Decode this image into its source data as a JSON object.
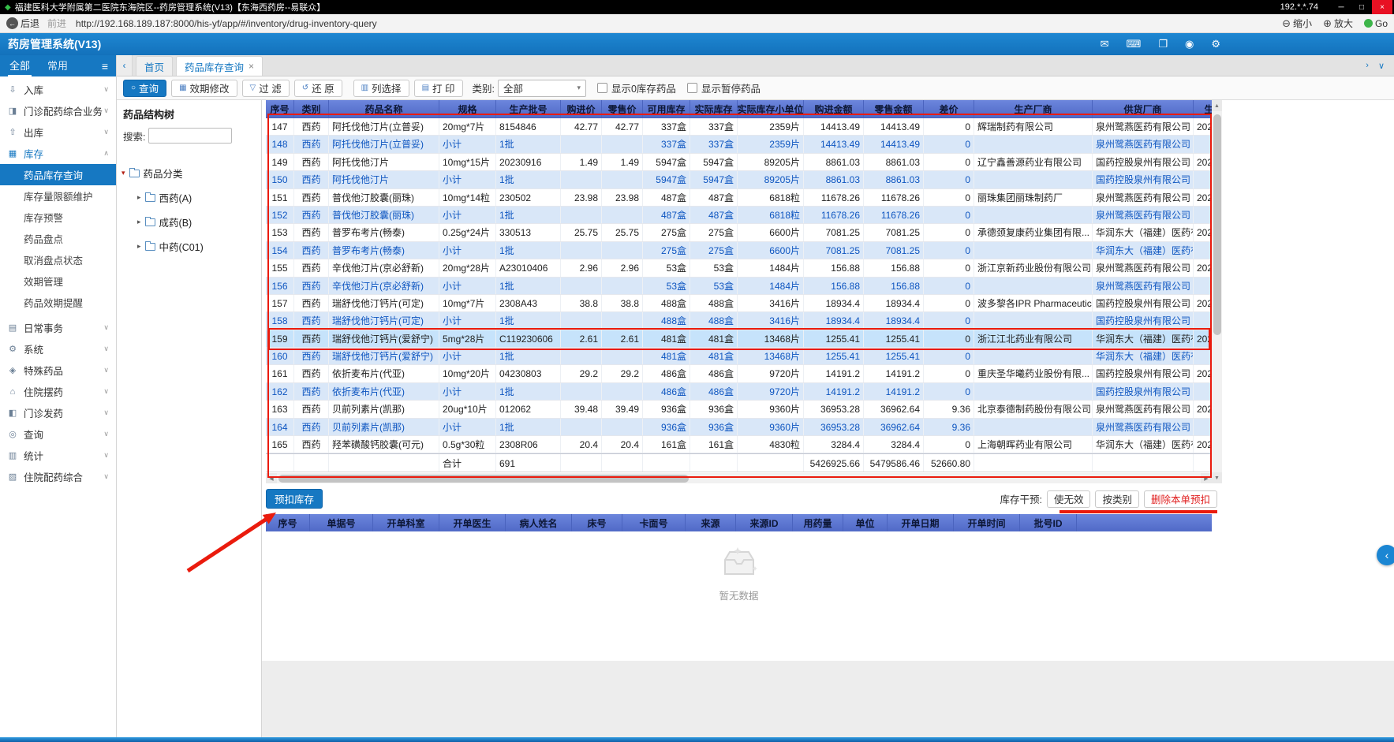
{
  "titlebar": {
    "title": "福建医科大学附属第二医院东海院区--药房管理系统(V13)【东海西药房--易联众】",
    "ip": "192.*.*.74",
    "minimize": "─",
    "maximize": "□",
    "close": "×"
  },
  "addressbar": {
    "back": "后退",
    "forward": "前进",
    "url": "http://192.168.189.187:8000/his-yf/app/#/inventory/drug-inventory-query",
    "zoom_out": "缩小",
    "zoom_in": "放大",
    "go": "Go"
  },
  "appbar": {
    "title": "药房管理系统(V13)",
    "icons": [
      "message-icon",
      "card-icon",
      "layout-icon",
      "monitor-icon",
      "gear-icon"
    ]
  },
  "sidebar": {
    "tabs": [
      {
        "label": "全部",
        "active": true
      },
      {
        "label": "常用",
        "active": false
      }
    ],
    "menu": [
      {
        "label": "入库",
        "icon": "inbound-icon",
        "kind": "item"
      },
      {
        "label": "门诊配药综合业务",
        "icon": "outpatient-icon",
        "kind": "item"
      },
      {
        "label": "出库",
        "icon": "outbound-icon",
        "kind": "item"
      },
      {
        "label": "库存",
        "icon": "stock-icon",
        "kind": "item",
        "active": true,
        "expanded": true
      },
      {
        "label": "药品库存查询",
        "kind": "sub",
        "selected": true
      },
      {
        "label": "库存量限额维护",
        "kind": "sub"
      },
      {
        "label": "库存预警",
        "kind": "sub"
      },
      {
        "label": "药品盘点",
        "kind": "sub"
      },
      {
        "label": "取消盘点状态",
        "kind": "sub"
      },
      {
        "label": "效期管理",
        "kind": "sub"
      },
      {
        "label": "药品效期提醒",
        "kind": "sub"
      },
      {
        "label": "日常事务",
        "icon": "daily-icon",
        "kind": "item",
        "gap": true
      },
      {
        "label": "系统",
        "icon": "system-icon",
        "kind": "item"
      },
      {
        "label": "特殊药品",
        "icon": "special-drug-icon",
        "kind": "item"
      },
      {
        "label": "住院摆药",
        "icon": "inpatient-dispense-icon",
        "kind": "item"
      },
      {
        "label": "门诊发药",
        "icon": "outpatient-dispense-icon",
        "kind": "item"
      },
      {
        "label": "查询",
        "icon": "query-icon",
        "kind": "item"
      },
      {
        "label": "统计",
        "icon": "stats-icon",
        "kind": "item"
      },
      {
        "label": "住院配药综合",
        "icon": "inpatient-combined-icon",
        "kind": "item"
      }
    ]
  },
  "tabbar": {
    "tabs": [
      {
        "label": "首页",
        "active": false,
        "closable": false
      },
      {
        "label": "药品库存查询",
        "active": true,
        "closable": true
      }
    ]
  },
  "toolbar": {
    "buttons": [
      {
        "label": "查询",
        "icon": "search-icon",
        "primary": true,
        "name": "query-button"
      },
      {
        "label": "效期修改",
        "icon": "calendar-icon",
        "name": "expiry-edit-button"
      },
      {
        "label": "过 滤",
        "icon": "filter-icon",
        "name": "filter-button"
      },
      {
        "label": "还 原",
        "icon": "restore-icon",
        "name": "restore-button"
      },
      {
        "label": "列选择",
        "icon": "columns-icon",
        "name": "column-select-button",
        "gap": true
      },
      {
        "label": "打 印",
        "icon": "print-icon",
        "name": "print-button"
      }
    ],
    "category_label": "类别:",
    "category_value": "全部",
    "checkboxes": [
      {
        "label": "显示0库存药品",
        "checked": false,
        "name": "show-zero-stock-checkbox"
      },
      {
        "label": "显示暂停药品",
        "checked": false,
        "name": "show-paused-drug-checkbox"
      }
    ]
  },
  "tree": {
    "title": "药品结构树",
    "search_label": "搜索:",
    "root": "药品分类",
    "nodes": [
      "西药(A)",
      "成药(B)",
      "中药(C01)"
    ]
  },
  "inventory_table": {
    "columns": [
      "序号",
      "类别",
      "药品名称",
      "规格",
      "生产批号",
      "购进价",
      "零售价",
      "可用库存",
      "实际库存",
      "实际库存小单位",
      "购进金额",
      "零售金额",
      "差价",
      "生产厂商",
      "供货厂商",
      "生"
    ],
    "rows": [
      {
        "type": "normal",
        "c": [
          "147",
          "西药",
          "阿托伐他汀片(立普妥)",
          "20mg*7片",
          "8154846",
          "42.77",
          "42.77",
          "337盒",
          "337盒",
          "2359片",
          "14413.49",
          "14413.49",
          "0",
          "辉瑞制药有限公司",
          "泉州鹭燕医药有限公司",
          "202"
        ]
      },
      {
        "type": "subtotal",
        "c": [
          "148",
          "西药",
          "阿托伐他汀片(立普妥)",
          "小计",
          "1批",
          "",
          "",
          "337盒",
          "337盒",
          "2359片",
          "14413.49",
          "14413.49",
          "0",
          "",
          "泉州鹭燕医药有限公司",
          ""
        ]
      },
      {
        "type": "normal",
        "c": [
          "149",
          "西药",
          "阿托伐他汀片",
          "10mg*15片",
          "20230916",
          "1.49",
          "1.49",
          "5947盒",
          "5947盒",
          "89205片",
          "8861.03",
          "8861.03",
          "0",
          "辽宁鑫善源药业有限公司",
          "国药控股泉州有限公司",
          "202"
        ]
      },
      {
        "type": "subtotal",
        "c": [
          "150",
          "西药",
          "阿托伐他汀片",
          "小计",
          "1批",
          "",
          "",
          "5947盒",
          "5947盒",
          "89205片",
          "8861.03",
          "8861.03",
          "0",
          "",
          "国药控股泉州有限公司",
          ""
        ]
      },
      {
        "type": "normal",
        "c": [
          "151",
          "西药",
          "普伐他汀胶囊(丽珠)",
          "10mg*14粒",
          "230502",
          "23.98",
          "23.98",
          "487盒",
          "487盒",
          "6818粒",
          "11678.26",
          "11678.26",
          "0",
          "丽珠集团丽珠制药厂",
          "泉州鹭燕医药有限公司",
          "202"
        ]
      },
      {
        "type": "subtotal",
        "c": [
          "152",
          "西药",
          "普伐他汀胶囊(丽珠)",
          "小计",
          "1批",
          "",
          "",
          "487盒",
          "487盒",
          "6818粒",
          "11678.26",
          "11678.26",
          "0",
          "",
          "泉州鹭燕医药有限公司",
          ""
        ]
      },
      {
        "type": "normal",
        "c": [
          "153",
          "西药",
          "普罗布考片(畅泰)",
          "0.25g*24片",
          "330513",
          "25.75",
          "25.75",
          "275盒",
          "275盒",
          "6600片",
          "7081.25",
          "7081.25",
          "0",
          "承德颈复康药业集团有限...",
          "华润东大（福建）医药有...",
          "202"
        ]
      },
      {
        "type": "subtotal",
        "c": [
          "154",
          "西药",
          "普罗布考片(畅泰)",
          "小计",
          "1批",
          "",
          "",
          "275盒",
          "275盒",
          "6600片",
          "7081.25",
          "7081.25",
          "0",
          "",
          "华润东大（福建）医药有...",
          ""
        ]
      },
      {
        "type": "normal",
        "c": [
          "155",
          "西药",
          "辛伐他汀片(京必舒新)",
          "20mg*28片",
          "A23010406",
          "2.96",
          "2.96",
          "53盒",
          "53盒",
          "1484片",
          "156.88",
          "156.88",
          "0",
          "浙江京新药业股份有限公司",
          "泉州鹭燕医药有限公司",
          "202"
        ]
      },
      {
        "type": "subtotal",
        "c": [
          "156",
          "西药",
          "辛伐他汀片(京必舒新)",
          "小计",
          "1批",
          "",
          "",
          "53盒",
          "53盒",
          "1484片",
          "156.88",
          "156.88",
          "0",
          "",
          "泉州鹭燕医药有限公司",
          ""
        ]
      },
      {
        "type": "normal",
        "c": [
          "157",
          "西药",
          "瑞舒伐他汀钙片(可定)",
          "10mg*7片",
          "2308A43",
          "38.8",
          "38.8",
          "488盒",
          "488盒",
          "3416片",
          "18934.4",
          "18934.4",
          "0",
          "波多黎各IPR Pharmaceutica...",
          "国药控股泉州有限公司",
          "202"
        ]
      },
      {
        "type": "subtotal",
        "c": [
          "158",
          "西药",
          "瑞舒伐他汀钙片(可定)",
          "小计",
          "1批",
          "",
          "",
          "488盒",
          "488盒",
          "3416片",
          "18934.4",
          "18934.4",
          "0",
          "",
          "国药控股泉州有限公司",
          ""
        ]
      },
      {
        "type": "selected",
        "c": [
          "159",
          "西药",
          "瑞舒伐他汀钙片(爱舒宁)",
          "5mg*28片",
          "C119230606",
          "2.61",
          "2.61",
          "481盒",
          "481盒",
          "13468片",
          "1255.41",
          "1255.41",
          "0",
          "浙江江北药业有限公司",
          "华润东大（福建）医药有...",
          "202"
        ]
      },
      {
        "type": "subtotal",
        "c": [
          "160",
          "西药",
          "瑞舒伐他汀钙片(爱舒宁)",
          "小计",
          "1批",
          "",
          "",
          "481盒",
          "481盒",
          "13468片",
          "1255.41",
          "1255.41",
          "0",
          "",
          "华润东大（福建）医药有...",
          ""
        ]
      },
      {
        "type": "normal",
        "c": [
          "161",
          "西药",
          "依折麦布片(代亚)",
          "10mg*20片",
          "04230803",
          "29.2",
          "29.2",
          "486盒",
          "486盒",
          "9720片",
          "14191.2",
          "14191.2",
          "0",
          "重庆圣华曦药业股份有限...",
          "国药控股泉州有限公司",
          "202"
        ]
      },
      {
        "type": "subtotal",
        "c": [
          "162",
          "西药",
          "依折麦布片(代亚)",
          "小计",
          "1批",
          "",
          "",
          "486盒",
          "486盒",
          "9720片",
          "14191.2",
          "14191.2",
          "0",
          "",
          "国药控股泉州有限公司",
          ""
        ]
      },
      {
        "type": "normal",
        "c": [
          "163",
          "西药",
          "贝前列素片(凯那)",
          "20ug*10片",
          "012062",
          "39.48",
          "39.49",
          "936盒",
          "936盒",
          "9360片",
          "36953.28",
          "36962.64",
          "9.36",
          "北京泰德制药股份有限公司",
          "泉州鹭燕医药有限公司",
          "202"
        ]
      },
      {
        "type": "subtotal",
        "c": [
          "164",
          "西药",
          "贝前列素片(凯那)",
          "小计",
          "1批",
          "",
          "",
          "936盒",
          "936盒",
          "9360片",
          "36953.28",
          "36962.64",
          "9.36",
          "",
          "泉州鹭燕医药有限公司",
          ""
        ]
      },
      {
        "type": "normal",
        "c": [
          "165",
          "西药",
          "羟苯磺酸钙胶囊(可元)",
          "0.5g*30粒",
          "2308R06",
          "20.4",
          "20.4",
          "161盒",
          "161盒",
          "4830粒",
          "3284.4",
          "3284.4",
          "0",
          "上海朝晖药业有限公司",
          "华润东大（福建）医药有...",
          "202"
        ]
      }
    ],
    "footer_cells": [
      "",
      "",
      "",
      "合计",
      "691",
      "",
      "",
      "",
      "",
      "",
      "5426925.66",
      "5479586.46",
      "52660.80",
      "",
      "",
      ""
    ]
  },
  "actions": {
    "withhold_button": "预扣库存",
    "intervention_label": "库存干预:",
    "buttons": [
      {
        "label": "使无效",
        "name": "invalidate-button",
        "danger": false
      },
      {
        "label": "按类别",
        "name": "by-category-button",
        "danger": false
      },
      {
        "label": "删除本单预扣",
        "name": "delete-withhold-button",
        "danger": true
      }
    ]
  },
  "withhold_table": {
    "columns": [
      "序号",
      "单据号",
      "开单科室",
      "开单医生",
      "病人姓名",
      "床号",
      "卡面号",
      "来源",
      "来源ID",
      "用药量",
      "单位",
      "开单日期",
      "开单时间",
      "批号ID"
    ],
    "empty_text": "暂无数据"
  }
}
